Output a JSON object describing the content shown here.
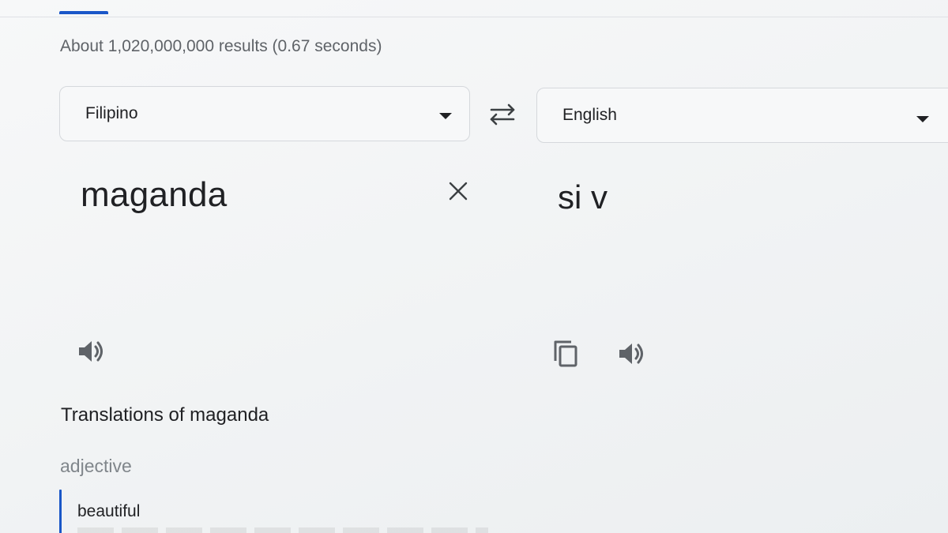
{
  "results": {
    "stats": "About 1,020,000,000 results (0.67 seconds)"
  },
  "translator": {
    "source_language": "Filipino",
    "target_language": "English",
    "source_text": "maganda",
    "target_text": "si v"
  },
  "dictionary": {
    "heading": "Translations of maganda",
    "part_of_speech": "adjective",
    "entries": [
      {
        "word": "beautiful"
      }
    ]
  },
  "colors": {
    "accent": "#1a57c8",
    "text_primary": "#202124",
    "text_secondary": "#5f6368",
    "icon": "#5f6368",
    "border": "#d5d8dc"
  },
  "icons": {
    "swap": "swap-arrows-icon",
    "clear": "close-icon",
    "speak": "speaker-icon",
    "copy": "copy-icon",
    "dropdown": "caret-down-icon"
  }
}
